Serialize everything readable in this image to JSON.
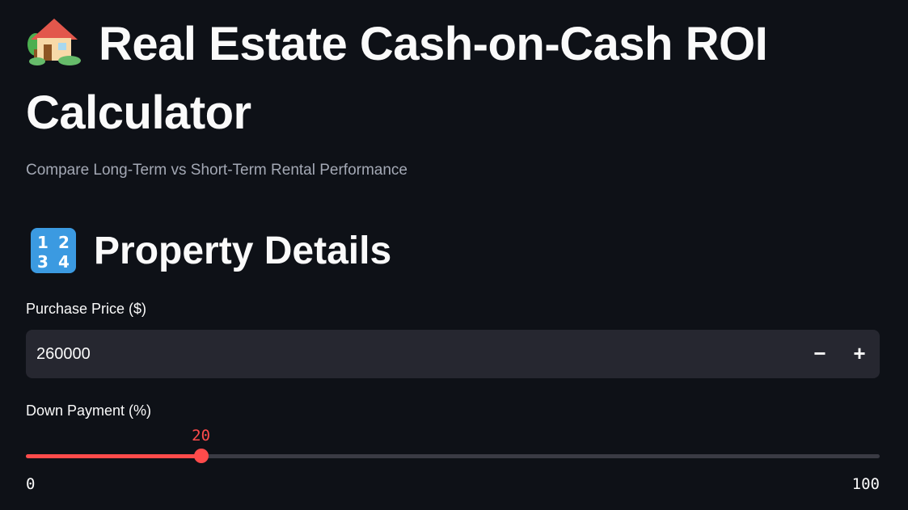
{
  "header": {
    "title_icon": "house-with-garden-icon",
    "title": "Real Estate Cash-on-Cash ROI Calculator",
    "subtitle": "Compare Long-Term vs Short-Term Rental Performance"
  },
  "section": {
    "icon": "input-numbers-icon",
    "heading": "Property Details"
  },
  "purchase_price": {
    "label": "Purchase Price ($)",
    "value": "260000",
    "decrement_label": "−",
    "increment_label": "+"
  },
  "down_payment": {
    "label": "Down Payment (%)",
    "value": 20,
    "min": 0,
    "max": 100,
    "value_text": "20",
    "min_text": "0",
    "max_text": "100"
  },
  "colors": {
    "background": "#0e1117",
    "accent": "#ff4b4b",
    "input_bg": "#262730",
    "muted_text": "#a3a8b4"
  }
}
